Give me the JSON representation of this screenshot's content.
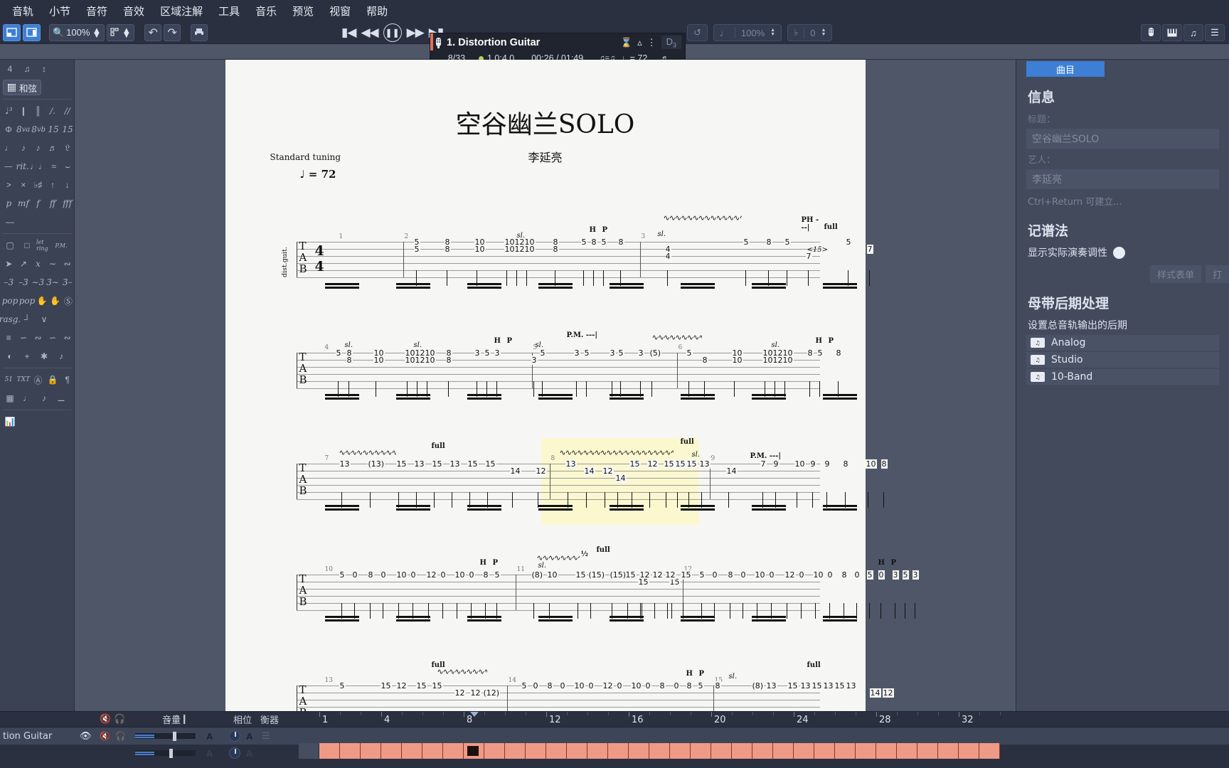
{
  "menubar": {
    "items": [
      "音轨",
      "小节",
      "音符",
      "音效",
      "区域注解",
      "工具",
      "音乐",
      "预览",
      "视窗",
      "帮助"
    ]
  },
  "toolbar": {
    "zoom_level": "100%",
    "undo_icon": "undo-icon",
    "redo_icon": "redo-icon",
    "print_icon": "print-icon",
    "page_view_icon": "page-view-icon",
    "layout_icon": "layout-icon",
    "search_icon": "search-icon",
    "loop_icon": "loop-icon",
    "tempo_percent": "100%",
    "transpose_value": "0"
  },
  "transport": {
    "first_icon": "skip-to-start-icon",
    "rewind_icon": "rewind-icon",
    "play_pause_icon": "pause-icon",
    "forward_icon": "fast-forward-icon",
    "last_icon": "skip-to-end-icon"
  },
  "nowplaying": {
    "track_icon": "guitar-headstock-icon",
    "title": "1. Distortion Guitar",
    "measure": "8/33",
    "position": "1.0:4.0",
    "time": "00:26 / 01:49",
    "feel": "♫=♫",
    "tempo": "♩= 72",
    "key": "D",
    "key_sub": "3",
    "metronome_icon": "metronome-icon",
    "countin_icon": "count-in-icon",
    "more_icon": "more-vertical-icon",
    "tuning_icon": "tuning-fork-icon"
  },
  "toolbar_right": {
    "icons": [
      "fretboard-icon",
      "keyboard-icon",
      "drum-icon",
      "mixer-icon"
    ]
  },
  "document": {
    "tab_title": "空谷幽兰"
  },
  "palette": {
    "top": {
      "bars_value": "4",
      "notes_icon": "notes-icon",
      "expand_icon": "expand-icon",
      "chord_icon": "chord-grid-icon",
      "chord_label": "和弦"
    },
    "rows": [
      [
        "3-tuplet-icon",
        "dashed-barline-icon",
        "double-barline-icon",
        "repeat-1-icon",
        "repeat-2-icon"
      ],
      [
        "coda-icon",
        "8va-icon",
        "8vb-icon",
        "15ma-icon",
        "15mb-icon"
      ],
      [
        "whole-note-icon",
        "quarter-note-icon",
        "eighth-note-icon",
        "sixteenth-note-icon",
        "rest-icon"
      ],
      [
        "dim-icon",
        "rit-icon",
        "dotted-note-icon",
        "tie-icon",
        "slur-icon"
      ],
      [
        "accent-icon",
        "x-note-icon",
        "accidental-icon",
        "upstroke-icon",
        "downstroke-icon"
      ],
      [
        "p-dynamic-icon",
        "mf-dynamic-icon",
        "f-dynamic-icon",
        "ff-dynamic-icon",
        "fff-dynamic-icon"
      ],
      [
        "crescendo-icon"
      ],
      [
        "palm-mute-icon",
        "let-ring-icon",
        "pm-icon"
      ],
      [
        "bend-icon",
        "bend-release-icon",
        "vibrato-wide-icon",
        "vibrato-icon",
        "tremolo-icon"
      ],
      [
        "grace-3-icon",
        "slide-in-icon",
        "slide-out-icon",
        "legato-slide-icon",
        "shift-slide-icon"
      ],
      [
        "pop-icon",
        "slap-icon",
        "left-hand-icon",
        "right-hand-icon",
        "fingering-6-icon"
      ],
      [
        "rasg-icon",
        "rasgueado-icon",
        "brush-down-icon",
        "brush-up-icon"
      ],
      [
        "arpeggio-icon",
        "trill-icon",
        "wide-vibrato-icon",
        "tremolo-picking-icon",
        "turn-icon"
      ],
      [
        "fade-icon",
        "harmonic-plus-icon",
        "artificial-harmonic-icon",
        "dead-note-icon"
      ],
      [
        "midi-icon",
        "text-icon",
        "letter-a-icon",
        "lock-icon",
        "paragraph-icon"
      ],
      [
        "section-icon",
        "auto-beam-icon",
        "beam-icon",
        "tuplet-bracket-icon"
      ],
      [
        "chart-icon"
      ]
    ]
  },
  "score": {
    "title": "空谷幽兰SOLO",
    "composer": "李延亮",
    "tuning": "Standard tuning",
    "tempo_marking": "♩ = 72",
    "clef_label": "TAB",
    "time_signature": "4/4",
    "instrument_label": "dist.guit.",
    "systems": [
      {
        "measure_numbers": [
          "1",
          "2",
          "3"
        ],
        "notes": "5 5 | 8 8 | 10 10 | 10 12 10 | 8 8 | 5 8 5 | 8 | 5 | 8 | 5 | 7 5 | 7",
        "annotations": [
          "sl.",
          "H",
          "P",
          "PH  - - -|",
          "full",
          "sl."
        ]
      },
      {
        "measure_numbers": [
          "4",
          "5",
          "6"
        ],
        "notes": "5 8 10 | 10 12 10 | 8 5 | 3 5 3 | 5 | 3 5 | 3 5 | 3 (5) | 5 8 10 | 10 12 10 | 8 5 8",
        "annotations": [
          "sl.",
          "sl.",
          "H",
          "P",
          "P.M. - - -|",
          "sl.",
          "H",
          "P"
        ]
      },
      {
        "measure_numbers": [
          "7",
          "8",
          "9"
        ],
        "notes": "13 (13) 15 13 15 13 15 15 | 14 12 | 13 14 12 14 | 15 12 15 15 15 13 | 14 | 7 9 10 9 9 | 8 10 8",
        "annotations": [
          "full",
          "full",
          "sl.",
          "P.M. - - -|"
        ]
      },
      {
        "measure_numbers": [
          "10",
          "11",
          "12"
        ],
        "notes": "5 0 8 0 10 0 12 0 10 0 8 5 | (8) 10 | 15 (15) (15) 15 12 12 15 12 15 15 | 5 0 8 0 10 0 12 0 10 0 8 0 5 0 3 5 3",
        "annotations": [
          "H",
          "P",
          "sl.",
          "½",
          "full",
          "H",
          "P"
        ]
      },
      {
        "measure_numbers": [
          "13",
          "14",
          "15"
        ],
        "notes": "5 15 12 15 15 12 12 (12) | 5 0 8 0 10 0 12 0 10 0 8 0 8 5 | 8 (8) 13 15 13 15 13 15 13 | 14 12",
        "annotations": [
          "full",
          "H",
          "P",
          "sl.",
          "full"
        ]
      }
    ],
    "selection_highlight": true
  },
  "rightpanel": {
    "tab": "曲目",
    "info_heading": "信息",
    "title_label": "标题：",
    "title_value": "空谷幽兰SOLO",
    "artist_label": "艺人：",
    "artist_value": "李延亮",
    "hint": "Ctrl+Return 可建立...",
    "notation_heading": "记谱法",
    "concert_pitch_label": "显示实际演奏调性",
    "style_sheet_btn": "样式表单",
    "print_btn": "打",
    "mastering_heading": "母带后期处理",
    "mastering_desc": "设置总音轨输出的后期",
    "presets": [
      {
        "icon": "preset-icon",
        "name": "Analog"
      },
      {
        "icon": "preset-icon",
        "name": "Studio"
      },
      {
        "icon": "preset-icon",
        "name": "10-Band"
      }
    ]
  },
  "bottom": {
    "headers": {
      "volume": "音量",
      "pan": "相位",
      "balance": "衡器"
    },
    "track_name": "tion Guitar",
    "eye_icon": "eye-icon",
    "mute_icon": "mute-icon",
    "solo_icon": "solo-headphone-icon",
    "automation_letter": "A",
    "ruler_numbers": [
      "1",
      "4",
      "8",
      "12",
      "16",
      "20",
      "24",
      "28",
      "32"
    ],
    "current_bar": 8,
    "total_bars": 33,
    "bar_color": "#ef9a86"
  }
}
